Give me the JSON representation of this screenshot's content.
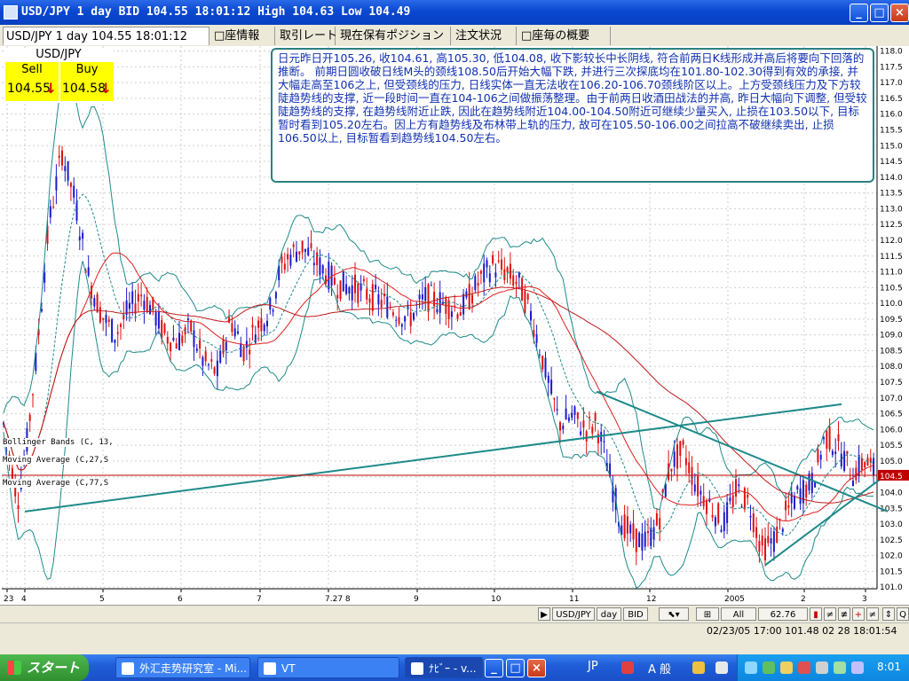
{
  "window": {
    "title": "USD/JPY 1 day BID 104.55 18:01:12 High 104.63 Low 104.49",
    "buttons": [
      "_",
      "□",
      "×"
    ]
  },
  "tabs": [
    {
      "label": "USD/JPY 1 day 104.55 18:01:12",
      "active": true
    },
    {
      "label": "□座情報"
    },
    {
      "label": "取引レート"
    },
    {
      "label": "現在保有ポジション"
    },
    {
      "label": "注文状況"
    },
    {
      "label": "□座毎の概要"
    }
  ],
  "price_panel": {
    "pair": "USD/JPY",
    "sell_label": "Sell",
    "sell_value": "104.55",
    "buy_label": "Buy",
    "buy_value": "104.58",
    "arrow": "↓"
  },
  "comment": "日元昨日开105.26, 收104.61, 高105.30, 低104.08, 收下影较长中长阴线, 符合前两日K线形成并高后将要向下回落的推断。\n前期日圆收破日线M头的颈线108.50后开始大幅下跌, 并进行三次探底均在101.80-102.30得到有效的承接, 并大幅走高至106之上, 但受颈线的压力, 日线实体一直无法收在106.20-106.70颈线阶区以上。上方受颈线压力及下方较陡趋势线的支撑, 近一段时间一直在104-106之间做振荡整理。由于前两日收酒田战法的并高, 昨日大幅向下调整, 但受较陡趋势线的支撑, 在趋势线附近止跌, 因此在趋势线附近104.00-104.50附近可继续少量买入, 止损在103.50以下, 目标暂时看到105.20左右。因上方有趋势线及布林带上轨的压力, 故可在105.50-106.00之间拉高不破继续卖出, 止损106.50以上, 目标暂看到趋势线104.50左右。",
  "indicators": [
    "Bollinger Bands (C, 13,",
    "Moving Average (C,27,S",
    "Moving Average (C,77,S"
  ],
  "chart_data": {
    "type": "candlestick",
    "y_ticks": [
      "118.0",
      "117.5",
      "117.0",
      "116.5",
      "116.0",
      "115.5",
      "115.0",
      "114.5",
      "114.0",
      "113.5",
      "113.0",
      "112.5",
      "112.0",
      "111.5",
      "111.0",
      "110.5",
      "110.0",
      "109.5",
      "109.0",
      "108.5",
      "108.0",
      "107.5",
      "107.0",
      "106.5",
      "106.0",
      "105.5",
      "105.0",
      "104.5",
      "104.0",
      "103.5",
      "103.0",
      "102.5",
      "102.0",
      "101.5",
      "101.0"
    ],
    "ylim": [
      101.0,
      118.0
    ],
    "x_labels": [
      "23",
      "4",
      "5",
      "6",
      "7",
      "7.27 8",
      "9",
      "10",
      "11",
      "12",
      "2005",
      "2",
      "3"
    ],
    "current_price_label": "104.5",
    "current_price": 104.55,
    "colors": {
      "up": "#1a1acc",
      "down": "#e01010",
      "bollinger": "#1e8a8a",
      "ma_fast": "#e02020",
      "ma_slow": "#c01a1a",
      "trendline": "#1e8a8a"
    }
  },
  "toolbar": {
    "pair": "USD/JPY",
    "period": "day",
    "side": "BID",
    "all": "All",
    "zoom": "62.76"
  },
  "status": "02/23/05 17:00   101.48 02 28 18:01:54",
  "taskbar": {
    "start": "スタート",
    "tasks": [
      "外汇走势研究室 - Mi...",
      "VT",
      "ﾅﾋﾞｰ - v..."
    ],
    "ime": "JP",
    "ime2": "A 般",
    "clock": "8:01"
  }
}
